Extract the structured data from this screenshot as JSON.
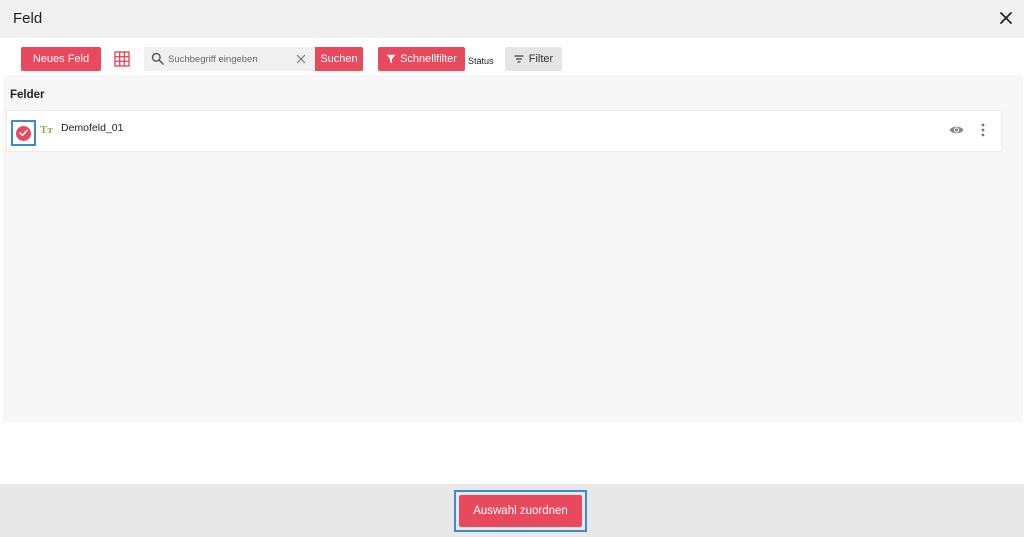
{
  "dialog": {
    "title": "Feld",
    "close_icon": "close-icon"
  },
  "toolbar": {
    "new_field_label": "Neues Feld",
    "grid_icon": "grid-icon",
    "search": {
      "placeholder": "Suchbegriff eingeben",
      "value": "",
      "button_label": "Suchen"
    },
    "quickfilter_label": "Schnellfilter",
    "status_label": "Status",
    "filter_label": "Filter"
  },
  "content": {
    "section_title": "Felder",
    "items": [
      {
        "name": "Demofeld_01",
        "type_icon_text": "Tт",
        "selected": true
      }
    ]
  },
  "footer": {
    "assign_label": "Auswahl zuordnen"
  },
  "colors": {
    "accent": "#e8495d",
    "focus_outline": "#3c8ad1",
    "type_icon": "#8bb540"
  }
}
